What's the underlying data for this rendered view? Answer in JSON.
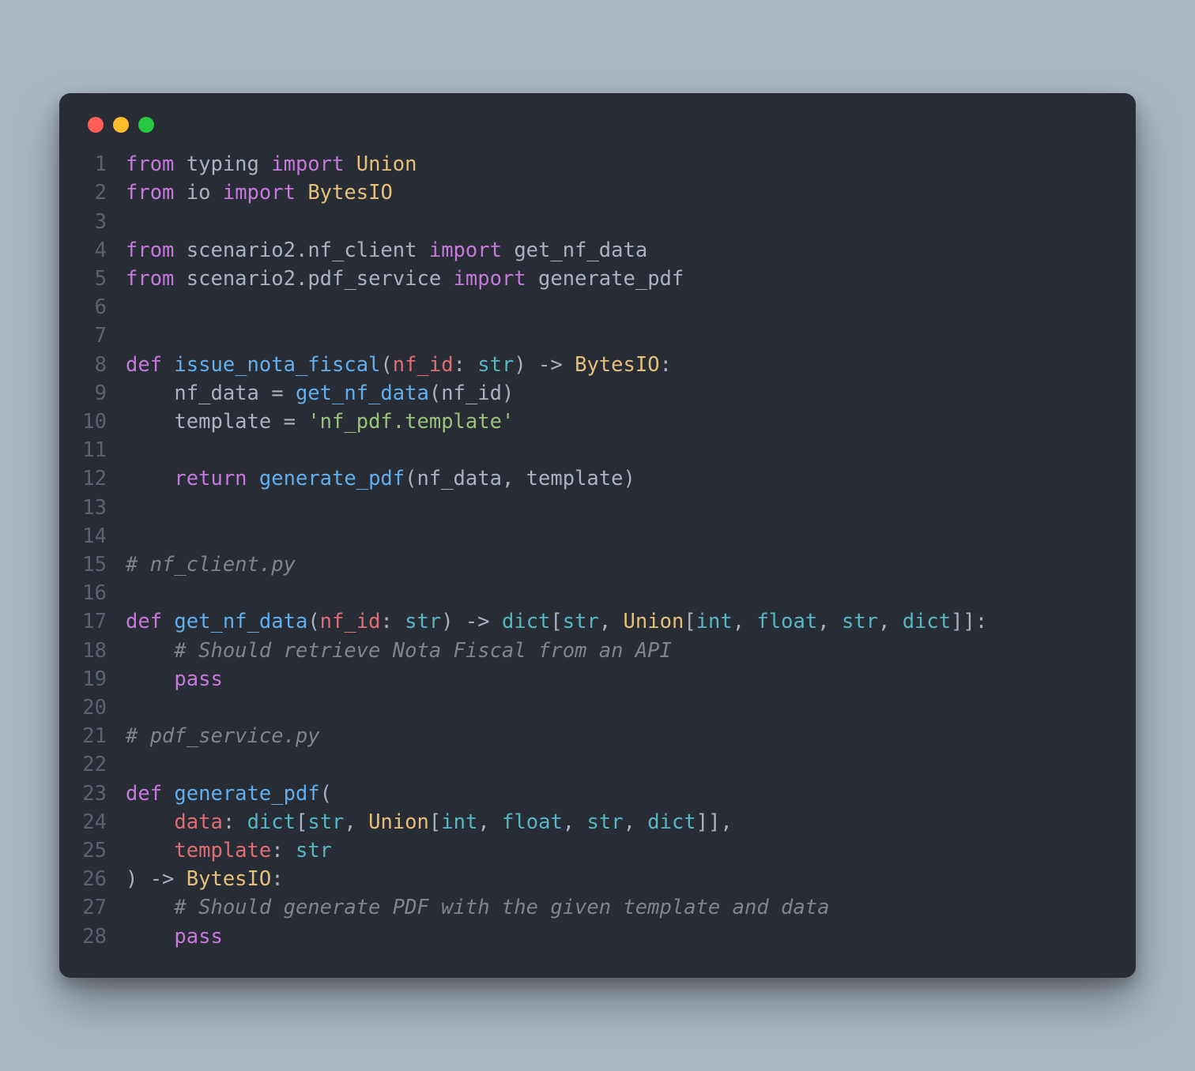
{
  "window": {
    "traffic_light_colors": {
      "red": "#ff5f56",
      "yellow": "#ffbd2e",
      "green": "#27c93f"
    }
  },
  "code": {
    "language": "python",
    "lines": [
      {
        "n": 1,
        "tokens": [
          [
            "kw",
            "from"
          ],
          [
            "pln",
            " typing "
          ],
          [
            "kw",
            "import"
          ],
          [
            "pln",
            " "
          ],
          [
            "cls",
            "Union"
          ]
        ]
      },
      {
        "n": 2,
        "tokens": [
          [
            "kw",
            "from"
          ],
          [
            "pln",
            " io "
          ],
          [
            "kw",
            "import"
          ],
          [
            "pln",
            " "
          ],
          [
            "cls",
            "BytesIO"
          ]
        ]
      },
      {
        "n": 3,
        "tokens": []
      },
      {
        "n": 4,
        "tokens": [
          [
            "kw",
            "from"
          ],
          [
            "pln",
            " scenario2"
          ],
          [
            "pln",
            "."
          ],
          [
            "pln",
            "nf_client "
          ],
          [
            "kw",
            "import"
          ],
          [
            "pln",
            " "
          ],
          [
            "pln",
            "get_nf_data"
          ]
        ]
      },
      {
        "n": 5,
        "tokens": [
          [
            "kw",
            "from"
          ],
          [
            "pln",
            " scenario2"
          ],
          [
            "pln",
            "."
          ],
          [
            "pln",
            "pdf_service "
          ],
          [
            "kw",
            "import"
          ],
          [
            "pln",
            " "
          ],
          [
            "pln",
            "generate_pdf"
          ]
        ]
      },
      {
        "n": 6,
        "tokens": []
      },
      {
        "n": 7,
        "tokens": []
      },
      {
        "n": 8,
        "tokens": [
          [
            "kw",
            "def"
          ],
          [
            "pln",
            " "
          ],
          [
            "fn",
            "issue_nota_fiscal"
          ],
          [
            "pln",
            "("
          ],
          [
            "var",
            "nf_id"
          ],
          [
            "pln",
            ": "
          ],
          [
            "ty",
            "str"
          ],
          [
            "pln",
            ") -> "
          ],
          [
            "cls",
            "BytesIO"
          ],
          [
            "pln",
            ":"
          ]
        ]
      },
      {
        "n": 9,
        "tokens": [
          [
            "pln",
            "    nf_data "
          ],
          [
            "op",
            "="
          ],
          [
            "pln",
            " "
          ],
          [
            "fn",
            "get_nf_data"
          ],
          [
            "pln",
            "(nf_id)"
          ]
        ]
      },
      {
        "n": 10,
        "tokens": [
          [
            "pln",
            "    template "
          ],
          [
            "op",
            "="
          ],
          [
            "pln",
            " "
          ],
          [
            "str",
            "'nf_pdf.template'"
          ]
        ]
      },
      {
        "n": 11,
        "tokens": []
      },
      {
        "n": 12,
        "tokens": [
          [
            "pln",
            "    "
          ],
          [
            "kw",
            "return"
          ],
          [
            "pln",
            " "
          ],
          [
            "fn",
            "generate_pdf"
          ],
          [
            "pln",
            "(nf_data, template)"
          ]
        ]
      },
      {
        "n": 13,
        "tokens": []
      },
      {
        "n": 14,
        "tokens": []
      },
      {
        "n": 15,
        "tokens": [
          [
            "cmt",
            "# nf_client.py"
          ]
        ]
      },
      {
        "n": 16,
        "tokens": []
      },
      {
        "n": 17,
        "tokens": [
          [
            "kw",
            "def"
          ],
          [
            "pln",
            " "
          ],
          [
            "fn",
            "get_nf_data"
          ],
          [
            "pln",
            "("
          ],
          [
            "var",
            "nf_id"
          ],
          [
            "pln",
            ": "
          ],
          [
            "ty",
            "str"
          ],
          [
            "pln",
            ") -> "
          ],
          [
            "ty",
            "dict"
          ],
          [
            "pln",
            "["
          ],
          [
            "ty",
            "str"
          ],
          [
            "pln",
            ", "
          ],
          [
            "cls",
            "Union"
          ],
          [
            "pln",
            "["
          ],
          [
            "ty",
            "int"
          ],
          [
            "pln",
            ", "
          ],
          [
            "ty",
            "float"
          ],
          [
            "pln",
            ", "
          ],
          [
            "ty",
            "str"
          ],
          [
            "pln",
            ", "
          ],
          [
            "ty",
            "dict"
          ],
          [
            "pln",
            "]]:"
          ]
        ]
      },
      {
        "n": 18,
        "tokens": [
          [
            "pln",
            "    "
          ],
          [
            "cmt",
            "# Should retrieve Nota Fiscal from an API"
          ]
        ]
      },
      {
        "n": 19,
        "tokens": [
          [
            "pln",
            "    "
          ],
          [
            "kw",
            "pass"
          ]
        ]
      },
      {
        "n": 20,
        "tokens": []
      },
      {
        "n": 21,
        "tokens": [
          [
            "cmt",
            "# pdf_service.py"
          ]
        ]
      },
      {
        "n": 22,
        "tokens": []
      },
      {
        "n": 23,
        "tokens": [
          [
            "kw",
            "def"
          ],
          [
            "pln",
            " "
          ],
          [
            "fn",
            "generate_pdf"
          ],
          [
            "pln",
            "("
          ]
        ]
      },
      {
        "n": 24,
        "tokens": [
          [
            "pln",
            "    "
          ],
          [
            "var",
            "data"
          ],
          [
            "pln",
            ": "
          ],
          [
            "ty",
            "dict"
          ],
          [
            "pln",
            "["
          ],
          [
            "ty",
            "str"
          ],
          [
            "pln",
            ", "
          ],
          [
            "cls",
            "Union"
          ],
          [
            "pln",
            "["
          ],
          [
            "ty",
            "int"
          ],
          [
            "pln",
            ", "
          ],
          [
            "ty",
            "float"
          ],
          [
            "pln",
            ", "
          ],
          [
            "ty",
            "str"
          ],
          [
            "pln",
            ", "
          ],
          [
            "ty",
            "dict"
          ],
          [
            "pln",
            "]],"
          ]
        ]
      },
      {
        "n": 25,
        "tokens": [
          [
            "pln",
            "    "
          ],
          [
            "var",
            "template"
          ],
          [
            "pln",
            ": "
          ],
          [
            "ty",
            "str"
          ]
        ]
      },
      {
        "n": 26,
        "tokens": [
          [
            "pln",
            ") -> "
          ],
          [
            "cls",
            "BytesIO"
          ],
          [
            "pln",
            ":"
          ]
        ]
      },
      {
        "n": 27,
        "tokens": [
          [
            "pln",
            "    "
          ],
          [
            "cmt",
            "# Should generate PDF with the given template and data"
          ]
        ]
      },
      {
        "n": 28,
        "tokens": [
          [
            "pln",
            "    "
          ],
          [
            "kw",
            "pass"
          ]
        ]
      }
    ]
  }
}
